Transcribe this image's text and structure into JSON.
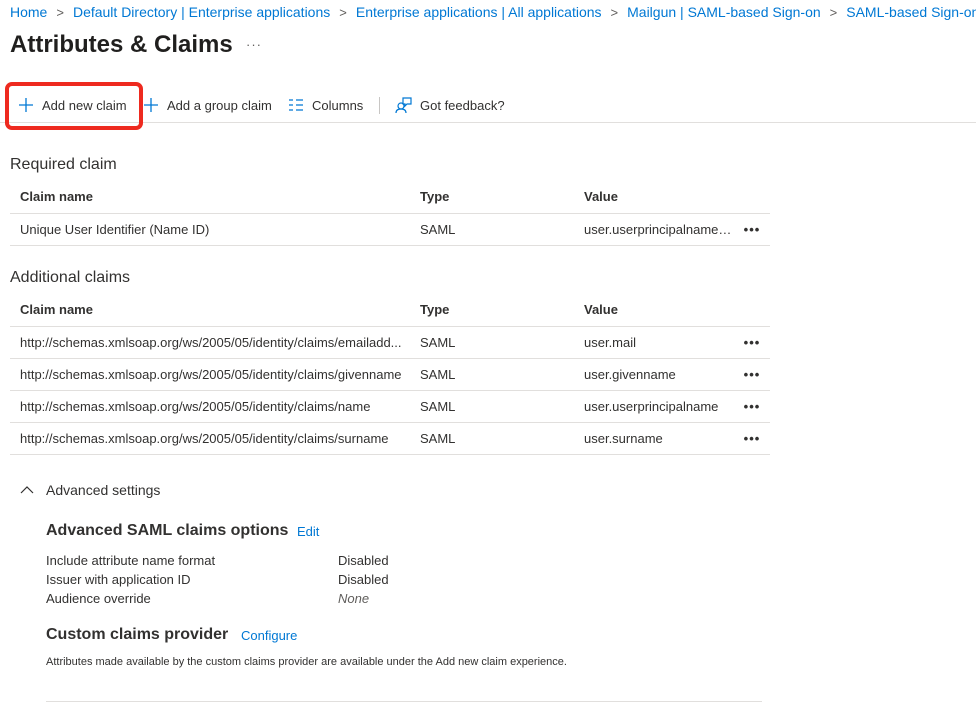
{
  "breadcrumb": [
    {
      "label": "Home"
    },
    {
      "label": "Default Directory | Enterprise applications"
    },
    {
      "label": "Enterprise applications | All applications"
    },
    {
      "label": "Mailgun | SAML-based Sign-on"
    },
    {
      "label": "SAML-based Sign-on"
    }
  ],
  "page": {
    "title": "Attributes & Claims",
    "more": "···"
  },
  "toolbar": {
    "add_new_claim": "Add new claim",
    "add_group_claim": "Add a group claim",
    "columns": "Columns",
    "feedback": "Got feedback?"
  },
  "required": {
    "title": "Required claim",
    "headers": {
      "name": "Claim name",
      "type": "Type",
      "value": "Value"
    },
    "rows": [
      {
        "name": "Unique User Identifier (Name ID)",
        "type": "SAML",
        "value": "user.userprincipalname [..."
      }
    ]
  },
  "additional": {
    "title": "Additional claims",
    "headers": {
      "name": "Claim name",
      "type": "Type",
      "value": "Value"
    },
    "rows": [
      {
        "name": "http://schemas.xmlsoap.org/ws/2005/05/identity/claims/emailadd...",
        "type": "SAML",
        "value": "user.mail"
      },
      {
        "name": "http://schemas.xmlsoap.org/ws/2005/05/identity/claims/givenname",
        "type": "SAML",
        "value": "user.givenname"
      },
      {
        "name": "http://schemas.xmlsoap.org/ws/2005/05/identity/claims/name",
        "type": "SAML",
        "value": "user.userprincipalname"
      },
      {
        "name": "http://schemas.xmlsoap.org/ws/2005/05/identity/claims/surname",
        "type": "SAML",
        "value": "user.surname"
      }
    ]
  },
  "row_more": "•••",
  "advanced": {
    "toggle_label": "Advanced settings",
    "saml_options": {
      "title": "Advanced SAML claims options",
      "edit": "Edit",
      "items": [
        {
          "label": "Include attribute name format",
          "value": "Disabled"
        },
        {
          "label": "Issuer with application ID",
          "value": "Disabled"
        },
        {
          "label": "Audience override",
          "value": "None"
        }
      ]
    },
    "custom_provider": {
      "title": "Custom claims provider",
      "configure": "Configure",
      "description": "Attributes made available by the custom claims provider are available under the Add new claim experience."
    }
  },
  "colors": {
    "accent": "#0078d4",
    "highlight": "#ee2a1f",
    "text": "#323130",
    "border": "#e1dfdd"
  }
}
